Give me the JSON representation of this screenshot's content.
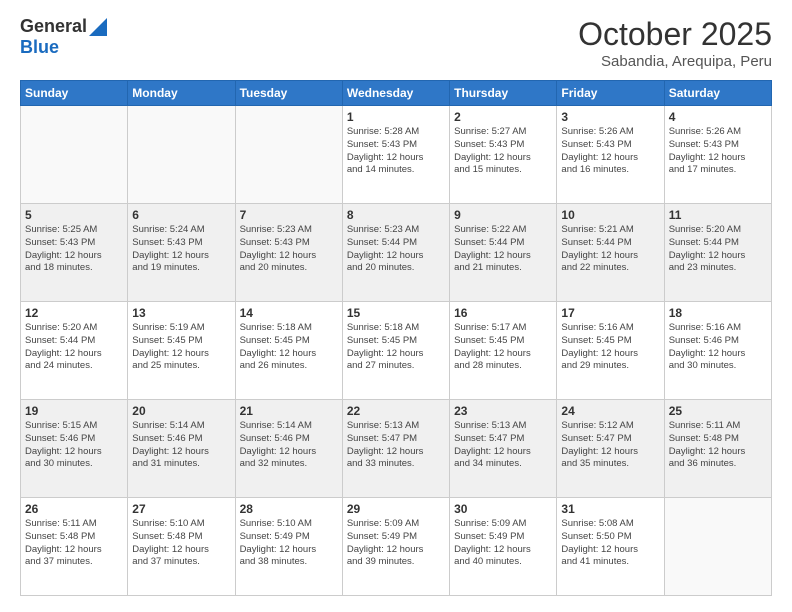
{
  "logo": {
    "general": "General",
    "blue": "Blue"
  },
  "title": "October 2025",
  "location": "Sabandia, Arequipa, Peru",
  "weekdays": [
    "Sunday",
    "Monday",
    "Tuesday",
    "Wednesday",
    "Thursday",
    "Friday",
    "Saturday"
  ],
  "weeks": [
    [
      {
        "day": "",
        "content": ""
      },
      {
        "day": "",
        "content": ""
      },
      {
        "day": "",
        "content": ""
      },
      {
        "day": "1",
        "content": "Sunrise: 5:28 AM\nSunset: 5:43 PM\nDaylight: 12 hours\nand 14 minutes."
      },
      {
        "day": "2",
        "content": "Sunrise: 5:27 AM\nSunset: 5:43 PM\nDaylight: 12 hours\nand 15 minutes."
      },
      {
        "day": "3",
        "content": "Sunrise: 5:26 AM\nSunset: 5:43 PM\nDaylight: 12 hours\nand 16 minutes."
      },
      {
        "day": "4",
        "content": "Sunrise: 5:26 AM\nSunset: 5:43 PM\nDaylight: 12 hours\nand 17 minutes."
      }
    ],
    [
      {
        "day": "5",
        "content": "Sunrise: 5:25 AM\nSunset: 5:43 PM\nDaylight: 12 hours\nand 18 minutes."
      },
      {
        "day": "6",
        "content": "Sunrise: 5:24 AM\nSunset: 5:43 PM\nDaylight: 12 hours\nand 19 minutes."
      },
      {
        "day": "7",
        "content": "Sunrise: 5:23 AM\nSunset: 5:43 PM\nDaylight: 12 hours\nand 20 minutes."
      },
      {
        "day": "8",
        "content": "Sunrise: 5:23 AM\nSunset: 5:44 PM\nDaylight: 12 hours\nand 20 minutes."
      },
      {
        "day": "9",
        "content": "Sunrise: 5:22 AM\nSunset: 5:44 PM\nDaylight: 12 hours\nand 21 minutes."
      },
      {
        "day": "10",
        "content": "Sunrise: 5:21 AM\nSunset: 5:44 PM\nDaylight: 12 hours\nand 22 minutes."
      },
      {
        "day": "11",
        "content": "Sunrise: 5:20 AM\nSunset: 5:44 PM\nDaylight: 12 hours\nand 23 minutes."
      }
    ],
    [
      {
        "day": "12",
        "content": "Sunrise: 5:20 AM\nSunset: 5:44 PM\nDaylight: 12 hours\nand 24 minutes."
      },
      {
        "day": "13",
        "content": "Sunrise: 5:19 AM\nSunset: 5:45 PM\nDaylight: 12 hours\nand 25 minutes."
      },
      {
        "day": "14",
        "content": "Sunrise: 5:18 AM\nSunset: 5:45 PM\nDaylight: 12 hours\nand 26 minutes."
      },
      {
        "day": "15",
        "content": "Sunrise: 5:18 AM\nSunset: 5:45 PM\nDaylight: 12 hours\nand 27 minutes."
      },
      {
        "day": "16",
        "content": "Sunrise: 5:17 AM\nSunset: 5:45 PM\nDaylight: 12 hours\nand 28 minutes."
      },
      {
        "day": "17",
        "content": "Sunrise: 5:16 AM\nSunset: 5:45 PM\nDaylight: 12 hours\nand 29 minutes."
      },
      {
        "day": "18",
        "content": "Sunrise: 5:16 AM\nSunset: 5:46 PM\nDaylight: 12 hours\nand 30 minutes."
      }
    ],
    [
      {
        "day": "19",
        "content": "Sunrise: 5:15 AM\nSunset: 5:46 PM\nDaylight: 12 hours\nand 30 minutes."
      },
      {
        "day": "20",
        "content": "Sunrise: 5:14 AM\nSunset: 5:46 PM\nDaylight: 12 hours\nand 31 minutes."
      },
      {
        "day": "21",
        "content": "Sunrise: 5:14 AM\nSunset: 5:46 PM\nDaylight: 12 hours\nand 32 minutes."
      },
      {
        "day": "22",
        "content": "Sunrise: 5:13 AM\nSunset: 5:47 PM\nDaylight: 12 hours\nand 33 minutes."
      },
      {
        "day": "23",
        "content": "Sunrise: 5:13 AM\nSunset: 5:47 PM\nDaylight: 12 hours\nand 34 minutes."
      },
      {
        "day": "24",
        "content": "Sunrise: 5:12 AM\nSunset: 5:47 PM\nDaylight: 12 hours\nand 35 minutes."
      },
      {
        "day": "25",
        "content": "Sunrise: 5:11 AM\nSunset: 5:48 PM\nDaylight: 12 hours\nand 36 minutes."
      }
    ],
    [
      {
        "day": "26",
        "content": "Sunrise: 5:11 AM\nSunset: 5:48 PM\nDaylight: 12 hours\nand 37 minutes."
      },
      {
        "day": "27",
        "content": "Sunrise: 5:10 AM\nSunset: 5:48 PM\nDaylight: 12 hours\nand 37 minutes."
      },
      {
        "day": "28",
        "content": "Sunrise: 5:10 AM\nSunset: 5:49 PM\nDaylight: 12 hours\nand 38 minutes."
      },
      {
        "day": "29",
        "content": "Sunrise: 5:09 AM\nSunset: 5:49 PM\nDaylight: 12 hours\nand 39 minutes."
      },
      {
        "day": "30",
        "content": "Sunrise: 5:09 AM\nSunset: 5:49 PM\nDaylight: 12 hours\nand 40 minutes."
      },
      {
        "day": "31",
        "content": "Sunrise: 5:08 AM\nSunset: 5:50 PM\nDaylight: 12 hours\nand 41 minutes."
      },
      {
        "day": "",
        "content": ""
      }
    ]
  ]
}
